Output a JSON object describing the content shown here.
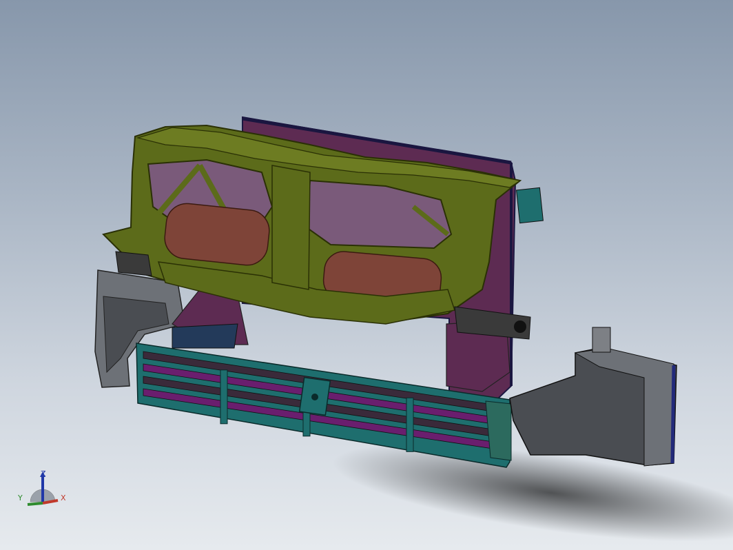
{
  "viewport": {
    "background_top": "#8797ab",
    "background_bottom": "#e6eaee"
  },
  "model": {
    "colors": {
      "frame": "#5c6b1a",
      "frame_edge": "#2a3005",
      "radiator": "#5d2b52",
      "radiator_edge": "#1a1640",
      "tank": "#7e4438",
      "shutter_frame": "#1e6e6e",
      "shutter_slat": "#6a1e6e",
      "duct": "#4a4d52",
      "duct_light": "#6d7177",
      "bracket": "#233a5a"
    }
  },
  "triad": {
    "x_label": "X",
    "y_label": "Y",
    "z_label": "Z",
    "colors": {
      "x": "#c0392b",
      "y": "#2e8b2e",
      "z": "#2038a8"
    }
  }
}
